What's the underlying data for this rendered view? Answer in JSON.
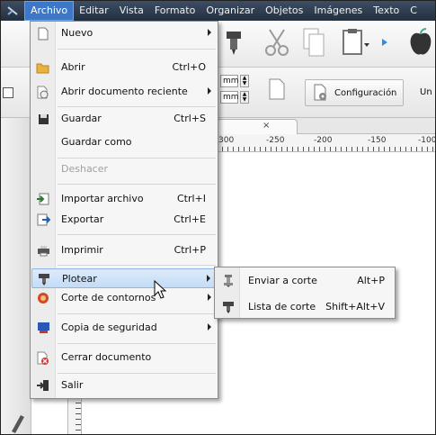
{
  "menubar": {
    "items": [
      "Archivo",
      "Editar",
      "Vista",
      "Formato",
      "Organizar",
      "Objetos",
      "Imágenes",
      "Texto",
      "C"
    ]
  },
  "toolbar": {
    "unit_top": "mm",
    "unit_bottom": "mm",
    "config_label": "Configuración",
    "trailing_label": "Un"
  },
  "ruler": {
    "labels": [
      "300",
      "-250",
      "-200",
      "-150",
      "-100"
    ]
  },
  "file_menu": {
    "items": [
      {
        "label": "Nuevo",
        "shortcut": "",
        "submenu": true,
        "icon": "new-document-icon"
      },
      {
        "label": "Abrir",
        "shortcut": "Ctrl+O",
        "submenu": false,
        "icon": "folder-open-icon"
      },
      {
        "label": "Abrir documento reciente",
        "shortcut": "",
        "submenu": true,
        "icon": "recent-document-icon"
      },
      {
        "label": "Guardar",
        "shortcut": "Ctrl+S",
        "submenu": false,
        "icon": "floppy-disk-icon"
      },
      {
        "label": "Guardar como",
        "shortcut": "",
        "submenu": false,
        "icon": ""
      },
      {
        "label": "Deshacer",
        "shortcut": "",
        "submenu": false,
        "icon": "",
        "disabled": true
      },
      {
        "label": "Importar archivo",
        "shortcut": "Ctrl+I",
        "submenu": false,
        "icon": "import-icon"
      },
      {
        "label": "Exportar",
        "shortcut": "Ctrl+E",
        "submenu": false,
        "icon": "export-icon"
      },
      {
        "label": "Imprimir",
        "shortcut": "Ctrl+P",
        "submenu": false,
        "icon": "printer-icon"
      },
      {
        "label": "Plotear",
        "shortcut": "",
        "submenu": true,
        "icon": "plotter-icon",
        "highlighted": true
      },
      {
        "label": "Corte de contornos",
        "shortcut": "",
        "submenu": true,
        "icon": "contour-cut-icon"
      },
      {
        "label": "Copia de seguridad",
        "shortcut": "",
        "submenu": true,
        "icon": "backup-icon"
      },
      {
        "label": "Cerrar documento",
        "shortcut": "",
        "submenu": false,
        "icon": "close-document-icon"
      },
      {
        "label": "Salir",
        "shortcut": "",
        "submenu": false,
        "icon": "exit-icon"
      }
    ]
  },
  "plot_submenu": {
    "items": [
      {
        "label": "Enviar a corte",
        "shortcut": "Alt+P",
        "icon": "send-to-cutter-icon"
      },
      {
        "label": "Lista de corte",
        "shortcut": "Shift+Alt+V",
        "icon": "cut-list-icon"
      }
    ]
  },
  "colors": {
    "menubar_bg": "#2c3a4d",
    "active_menu": "#3d78c8",
    "highlight": "#c4dcf6"
  }
}
